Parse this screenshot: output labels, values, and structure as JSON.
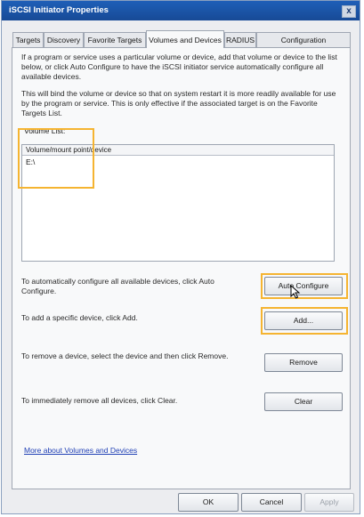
{
  "window": {
    "title": "iSCSI Initiator Properties",
    "close_glyph": "x"
  },
  "tabs": [
    {
      "label": "Targets",
      "active": false
    },
    {
      "label": "Discovery",
      "active": false
    },
    {
      "label": "Favorite Targets",
      "active": false
    },
    {
      "label": "Volumes and Devices",
      "active": true
    },
    {
      "label": "RADIUS",
      "active": false
    },
    {
      "label": "Configuration",
      "active": false
    }
  ],
  "intro": {
    "para1": "If a program or service uses a particular volume or device, add that volume or device to the list below, or click Auto Configure to have the iSCSI initiator service automatically configure all available devices.",
    "para2": "This will bind the volume or device so that on system restart it is more readily available for use by the program or service. This is only effective if the associated target is on the Favorite Targets List."
  },
  "volume_list": {
    "label": "Volume List:",
    "column_header": "Volume/mount point/device",
    "items": [
      "E:\\"
    ]
  },
  "actions": {
    "auto_configure": {
      "description": "To automatically configure all available devices, click Auto Configure.",
      "label": "Auto Configure"
    },
    "add": {
      "description": "To add a specific device, click Add.",
      "label": "Add..."
    },
    "remove": {
      "description": "To remove a device, select the device and then click Remove.",
      "label": "Remove"
    },
    "clear": {
      "description": "To immediately remove all devices, click Clear.",
      "label": "Clear"
    }
  },
  "help_link": "More about Volumes and Devices",
  "dialog_buttons": {
    "ok": "OK",
    "cancel": "Cancel",
    "apply": "Apply"
  },
  "colors": {
    "highlight": "#f5b431",
    "titlebar": "#1f5fb8",
    "link": "#1f3fb5"
  }
}
